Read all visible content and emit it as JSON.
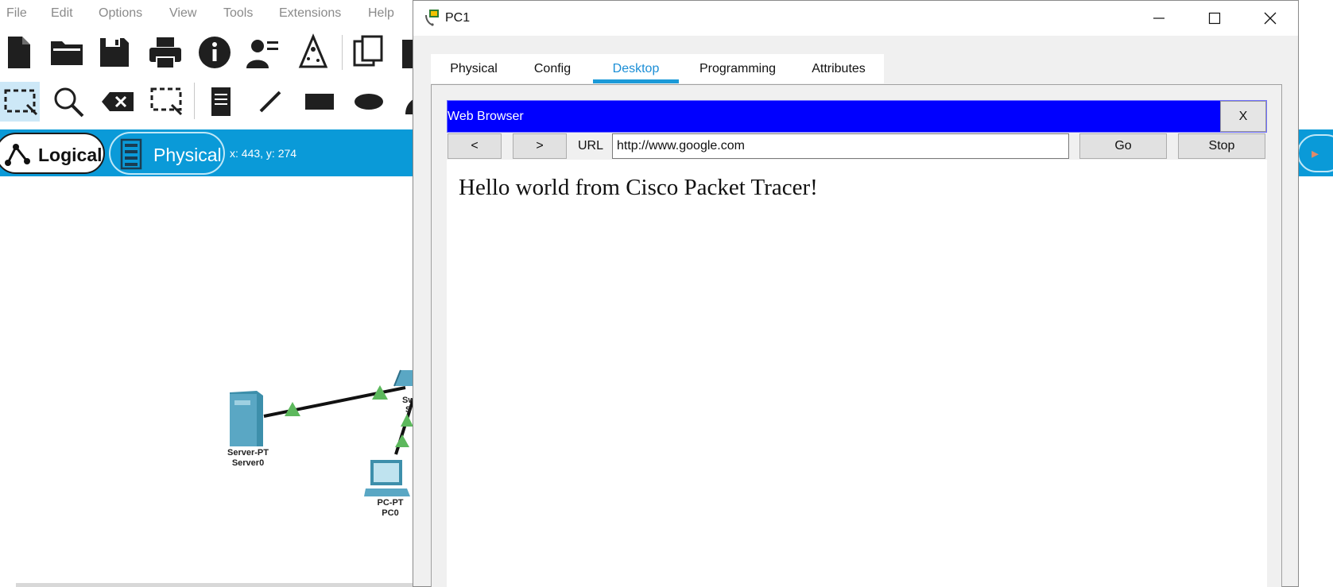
{
  "main_window": {
    "menu": [
      "File",
      "Edit",
      "Options",
      "View",
      "Tools",
      "Extensions",
      "Help"
    ],
    "modes": {
      "logical_label": "Logical",
      "physical_label": "Physical"
    },
    "coordinates": "x: 443, y: 274",
    "devices": {
      "server": {
        "type": "Server-PT",
        "name": "Server0"
      },
      "pc": {
        "type": "PC-PT",
        "name": "PC0"
      },
      "switch_partial": {
        "type": "Sw",
        "name": "S"
      }
    },
    "colors": {
      "mode_bar": "#0a9ad8",
      "link_up": "#5cb85c",
      "menu_text": "#8a8a8a"
    }
  },
  "dialog": {
    "title": "PC1",
    "tabs": [
      {
        "label": "Physical",
        "active": false
      },
      {
        "label": "Config",
        "active": false
      },
      {
        "label": "Desktop",
        "active": true
      },
      {
        "label": "Programming",
        "active": false
      },
      {
        "label": "Attributes",
        "active": false
      }
    ],
    "web_browser": {
      "title": "Web Browser",
      "close_label": "X",
      "back_label": "<",
      "forward_label": ">",
      "url_label": "URL",
      "url_value": "http://www.google.com",
      "go_label": "Go",
      "stop_label": "Stop",
      "page_content": "Hello world from Cisco Packet Tracer!"
    },
    "colors": {
      "browser_header": "#0000ff",
      "active_tab": "#1b9ad8"
    }
  }
}
